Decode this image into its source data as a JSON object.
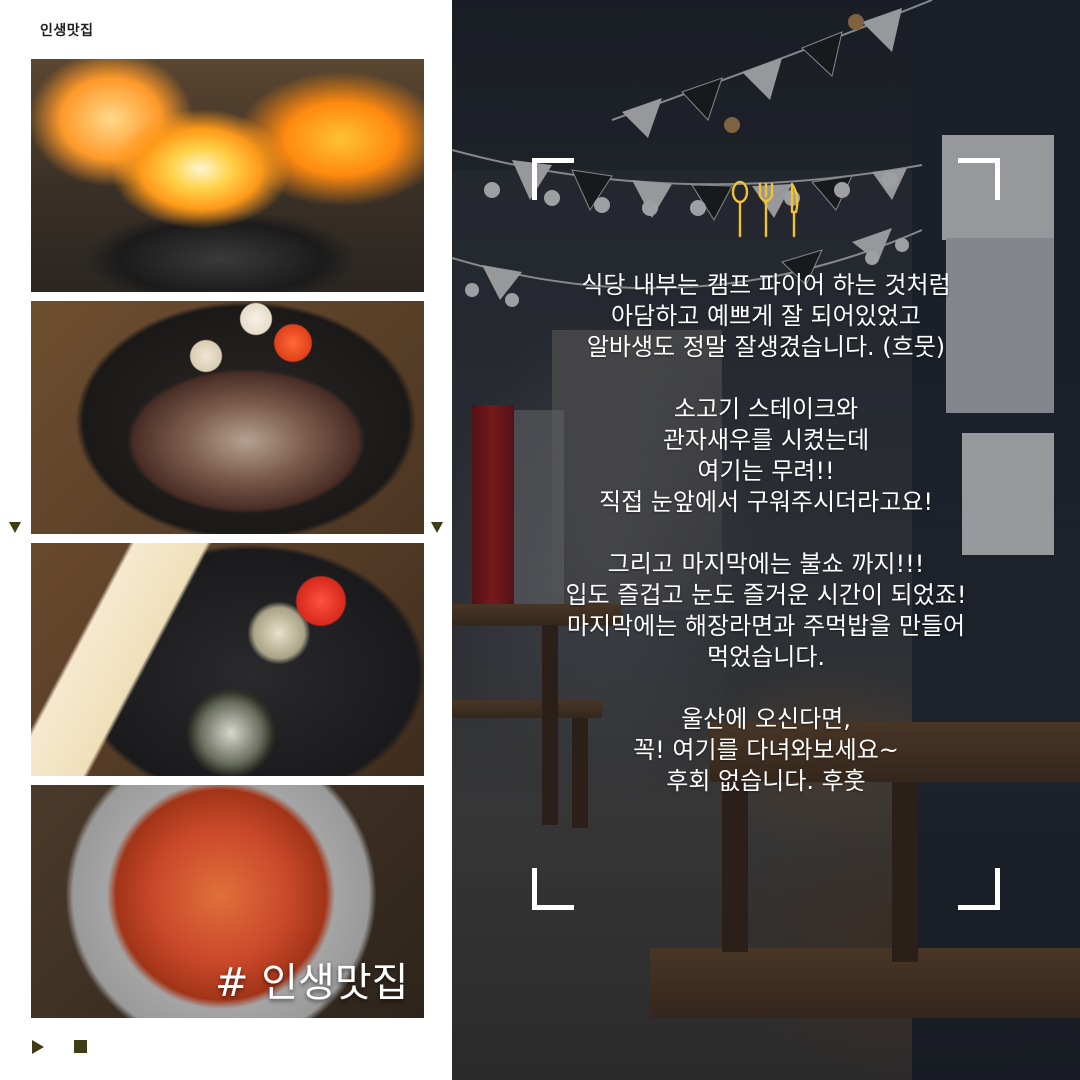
{
  "brand": {
    "name": "인생맛집"
  },
  "photos": [
    {
      "subject": "flambe-fire-pan"
    },
    {
      "subject": "beef-steak-skillet"
    },
    {
      "subject": "toast-rice-balls"
    },
    {
      "subject": "haejang-ramyeon",
      "hashtag": "# 인생맛집"
    }
  ],
  "story": {
    "lines": [
      "식당 내부는 캠프 파이어 하는 것처럼",
      "아담하고 예쁘게 잘 되어있었고",
      "알바생도 정말 잘생겼습니다. (흐뭇)",
      "",
      "소고기 스테이크와",
      "관자새우를 시켰는데",
      "여기는 무려!!",
      "직접 눈앞에서 구워주시더라고요!",
      "",
      "그리고 마지막에는 불쇼 까지!!!",
      "입도 즐겁고 눈도 즐거운 시간이 되었죠!",
      "마지막에는 해장라면과 주먹밥을 만들어",
      "먹었습니다.",
      "",
      "울산에 오신다면,",
      "꼭! 여기를 다녀와보세요~",
      "후회 없습니다. 후훗"
    ]
  },
  "icons": {
    "cutlery": "cutlery-icon",
    "prev": "triangle-down-icon",
    "play": "play-icon",
    "stop": "stop-icon"
  },
  "colors": {
    "accent": "#3f3d17",
    "cutlery": "#f2c230",
    "text": "#ffffff"
  }
}
